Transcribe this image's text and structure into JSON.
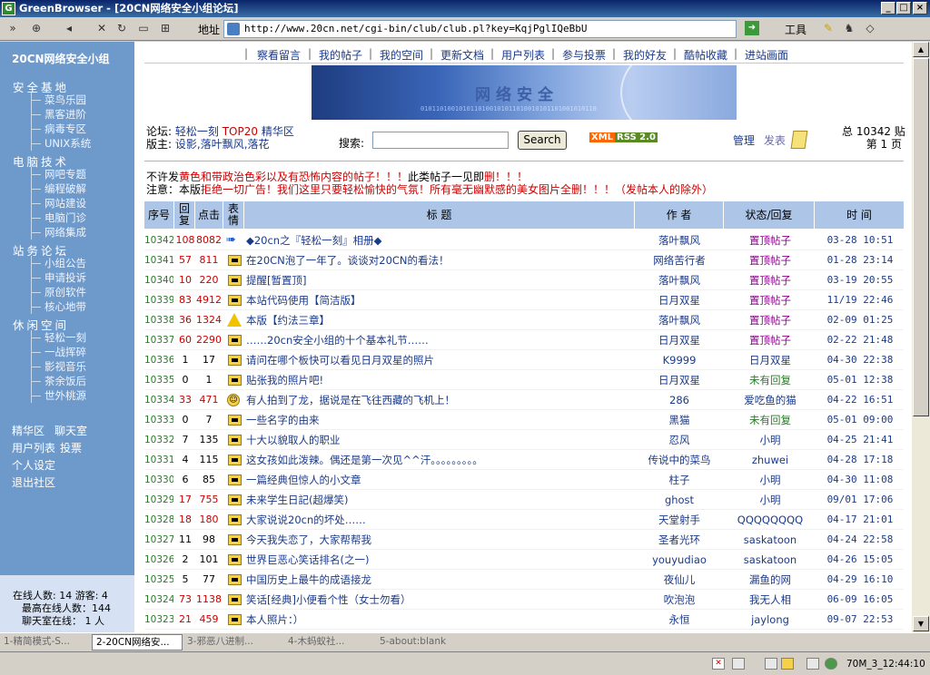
{
  "window": {
    "title": "GreenBrowser - [20CN网络安全小组论坛]",
    "app_icon": "G"
  },
  "toolbar": {
    "address_label": "地址",
    "url": "http://www.20cn.net/cgi-bin/club/club.pl?key=KqjPglIQeBbU",
    "tools_label": "工具"
  },
  "sidebar": {
    "title": "20CN网络安全小组",
    "groups": [
      {
        "label": "安全基地",
        "items": [
          "菜鸟乐园",
          "黑客进阶",
          "病毒专区",
          "UNIX系统"
        ]
      },
      {
        "label": "电脑技术",
        "items": [
          "网吧专题",
          "编程破解",
          "网站建设",
          "电脑门诊",
          "网络集成"
        ]
      },
      {
        "label": "站务论坛",
        "items": [
          "小组公告",
          "申请投诉",
          "原创软件",
          "核心地带"
        ]
      },
      {
        "label": "休闲空间",
        "items": [
          "轻松一刻",
          "一战挥碎",
          "影视音乐",
          "茶余饭后",
          "世外桃源"
        ]
      }
    ],
    "links": [
      "精华区",
      "聊天室",
      "用户列表",
      "投票",
      "个人设定",
      "退出社区"
    ],
    "online": {
      "users": "在线人数: 14 游客: 4",
      "max": "最高在线人数：144",
      "chat": "聊天室在线： 1 人"
    }
  },
  "topnav": [
    "察看留言",
    "我的帖子",
    "我的空间",
    "更新文档",
    "用户列表",
    "参与投票",
    "我的好友",
    "酷帖收藏",
    "进站画面"
  ],
  "banner": {
    "text": "网络安全"
  },
  "forum": {
    "label": "论坛:",
    "name": "轻松一刻",
    "top20": "TOP20",
    "elite": "精华区",
    "moderator_label": "版主:",
    "moderators": "设影,落叶飘风,落花",
    "search_label": "搜索:",
    "search_value": "",
    "search_button": "Search",
    "xml_left": "XML",
    "xml_right": "RSS 2.0",
    "manage": "管理",
    "post": "发表",
    "total": "总 10342 贴",
    "page": "第 1 页"
  },
  "notice": {
    "line1_a": "不许发",
    "line1_b": "黄色和带政治色彩以及有恐怖内容的帖子！！！",
    "line1_c": "此类帖子一见即",
    "line1_d": "删！！！",
    "line2_a": "注意：本版",
    "line2_b": "拒绝一切广告！我们这里只要轻松愉快的气氛！所有毫无幽默感的美女图片全删！！！（发帖本人的除外）"
  },
  "table": {
    "headers": {
      "id": "序号",
      "reply": "回复",
      "click": "点击",
      "mood": "表情",
      "title": "标 题",
      "author": "作 者",
      "status": "状态/回复",
      "time": "时 间"
    },
    "rows": [
      {
        "id": "10342",
        "reply": "108",
        "click": "8082",
        "icon": "arrow",
        "title": "◆20cn之『轻松一刻』相册◆",
        "author": "落叶飘风",
        "status": "置顶帖子",
        "st": "top",
        "time": "03-28 10:51",
        "hot": true
      },
      {
        "id": "10341",
        "reply": "57",
        "click": "811",
        "icon": "folder",
        "title": "在20CN泡了一年了。谈谈对20CN的看法！",
        "author": "网络苦行者",
        "status": "置顶帖子",
        "st": "top",
        "time": "01-28 23:14",
        "hot": true
      },
      {
        "id": "10340",
        "reply": "10",
        "click": "220",
        "icon": "folder",
        "title": "提醒[暂置顶]",
        "author": "落叶飘风",
        "status": "置顶帖子",
        "st": "top",
        "time": "03-19 20:55",
        "hot": true
      },
      {
        "id": "10339",
        "reply": "83",
        "click": "4912",
        "icon": "folder",
        "title": "本站代码使用【简洁版】",
        "author": "日月双星",
        "status": "置顶帖子",
        "st": "top",
        "time": "11/19 22:46",
        "hot": true
      },
      {
        "id": "10338",
        "reply": "36",
        "click": "1324",
        "icon": "warn",
        "title": "本版【约法三章】",
        "author": "落叶飘风",
        "status": "置顶帖子",
        "st": "top",
        "time": "02-09 01:25",
        "hot": true
      },
      {
        "id": "10337",
        "reply": "60",
        "click": "2290",
        "icon": "folder",
        "title": "……20cn安全小组的十个基本礼节……",
        "author": "日月双星",
        "status": "置顶帖子",
        "st": "top",
        "time": "02-22 21:48",
        "hot": true
      },
      {
        "id": "10336",
        "reply": "1",
        "click": "17",
        "icon": "folder",
        "title": "请问在哪个板快可以看见日月双星的照片",
        "author": "K9999",
        "status": "日月双星",
        "st": "user",
        "time": "04-30 22:38",
        "hot": false
      },
      {
        "id": "10335",
        "reply": "0",
        "click": "1",
        "icon": "folder",
        "title": "贴张我的照片吧!",
        "author": "日月双星",
        "status": "未有回复",
        "st": "none",
        "time": "05-01 12:38",
        "hot": false
      },
      {
        "id": "10334",
        "reply": "33",
        "click": "471",
        "icon": "smile",
        "title": "有人拍到了龙，据说是在飞往西藏的飞机上！",
        "author": "286",
        "status": "爱吃鱼的猫",
        "st": "user",
        "time": "04-22 16:51",
        "hot": true
      },
      {
        "id": "10333",
        "reply": "0",
        "click": "7",
        "icon": "folder",
        "title": "一些名字的由来",
        "author": "黑猫",
        "status": "未有回复",
        "st": "none",
        "time": "05-01 09:00",
        "hot": false
      },
      {
        "id": "10332",
        "reply": "7",
        "click": "135",
        "icon": "folder",
        "title": "十大以貌取人的职业",
        "author": "忍风",
        "status": "小明",
        "st": "user",
        "time": "04-25 21:41",
        "hot": false
      },
      {
        "id": "10331",
        "reply": "4",
        "click": "115",
        "icon": "folder",
        "title": "这女孩如此泼辣。偶还是第一次见^^汗。。。。。。。。。",
        "author": "传说中的菜鸟",
        "status": "zhuwei",
        "st": "user",
        "time": "04-28 17:18",
        "hot": false
      },
      {
        "id": "10330",
        "reply": "6",
        "click": "85",
        "icon": "folder",
        "title": "一篇经典但惊人的小文章",
        "author": "柱子",
        "status": "小明",
        "st": "user",
        "time": "04-30 11:08",
        "hot": false
      },
      {
        "id": "10329",
        "reply": "17",
        "click": "755",
        "icon": "folder",
        "title": "未来学生日記(超爆笑)",
        "author": "ghost",
        "status": "小明",
        "st": "user",
        "time": "09/01 17:06",
        "hot": true
      },
      {
        "id": "10328",
        "reply": "18",
        "click": "180",
        "icon": "folder",
        "title": "大家说说20cn的坏处……",
        "author": "天堂射手",
        "status": "QQQQQQQQ",
        "st": "user",
        "time": "04-17 21:01",
        "hot": true
      },
      {
        "id": "10327",
        "reply": "11",
        "click": "98",
        "icon": "folder",
        "title": "今天我失恋了，大家帮帮我",
        "author": "圣者光环",
        "status": "saskatoon",
        "st": "user",
        "time": "04-24 22:58",
        "hot": false
      },
      {
        "id": "10326",
        "reply": "2",
        "click": "101",
        "icon": "folder",
        "title": "世界巨恶心笑话排名(之一)",
        "author": "youyudiao",
        "status": "saskatoon",
        "st": "user",
        "time": "04-26 15:05",
        "hot": false
      },
      {
        "id": "10325",
        "reply": "5",
        "click": "77",
        "icon": "folder",
        "title": "中国历史上最牛的成语接龙",
        "author": "夜仙儿",
        "status": "漏鱼的网",
        "st": "user",
        "time": "04-29 16:10",
        "hot": false
      },
      {
        "id": "10324",
        "reply": "73",
        "click": "1138",
        "icon": "folder",
        "title": "笑话[经典]小便看个性（女士勿看）",
        "author": "吹泡泡",
        "status": "我无人相",
        "st": "user",
        "time": "06-09 16:05",
        "hot": true
      },
      {
        "id": "10323",
        "reply": "21",
        "click": "459",
        "icon": "folder",
        "title": "本人照片：）",
        "author": "永恒",
        "status": "jaylong",
        "st": "user",
        "time": "09-07 22:53",
        "hot": true
      }
    ]
  },
  "tabs": [
    "1-精简模式-S...",
    "2-20CN网络安...",
    "3-邪恶八进制...",
    "4-木蚂蚁社...",
    "5-about:blank"
  ],
  "status": {
    "clock": "70M_3_12:44:10"
  }
}
